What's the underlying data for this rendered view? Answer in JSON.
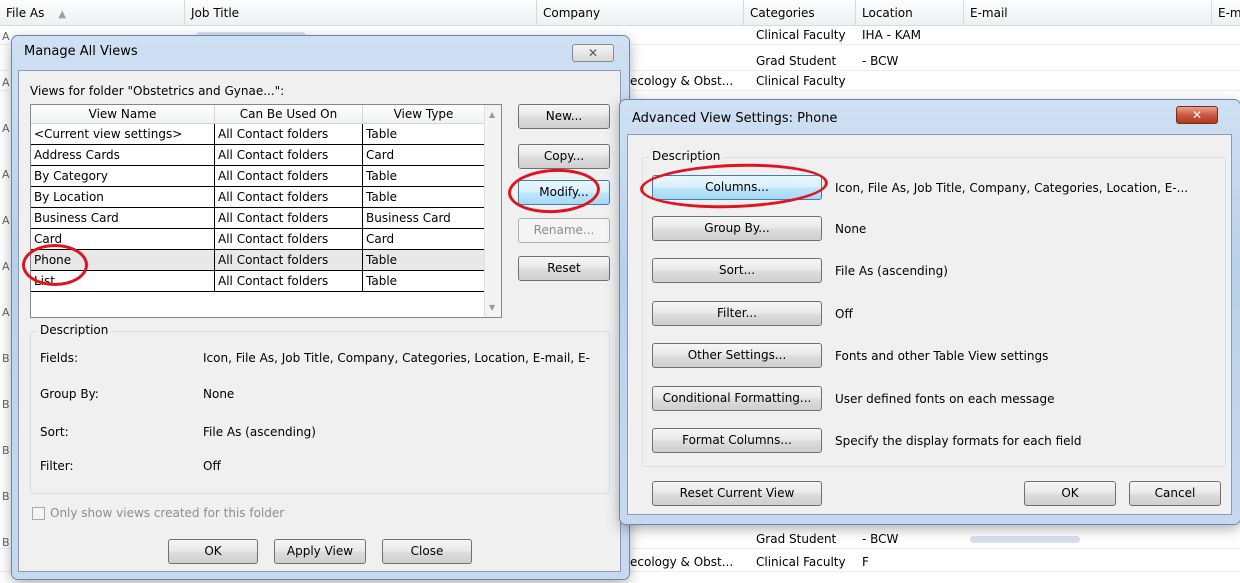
{
  "contacts": {
    "headers": {
      "file_as": "File As",
      "job_title": "Job Title",
      "company": "Company",
      "categories": "Categories",
      "location": "Location",
      "email": "E-mail",
      "email2": "E-m"
    },
    "rows": [
      {
        "company": "",
        "category": "Clinical Faculty",
        "location": "IHA - KAM"
      },
      {
        "company": "",
        "category": "Grad Student",
        "location": "- BCW"
      },
      {
        "company": "ecology & Obst...",
        "category": "Clinical Faculty",
        "location": ""
      },
      {
        "company": "",
        "category": "",
        "location": ""
      },
      {
        "company": "ecology & Obst...",
        "category": "",
        "location": ""
      },
      {
        "company": "",
        "category": "Grad Student",
        "location": "- BCW"
      },
      {
        "company": "ecology & Obst...",
        "category": "Clinical Faculty",
        "location": "F"
      }
    ]
  },
  "manage_views": {
    "title": "Manage All Views",
    "close_icon": "✕",
    "folder_label": "Views for folder \"Obstetrics and Gynae...\":",
    "columns": [
      "View Name",
      "Can Be Used On",
      "View Type"
    ],
    "views": [
      {
        "name": "<Current view settings>",
        "used_on": "All Contact folders",
        "type": "Table"
      },
      {
        "name": "Address Cards",
        "used_on": "All Contact folders",
        "type": "Card"
      },
      {
        "name": "By Category",
        "used_on": "All Contact folders",
        "type": "Table"
      },
      {
        "name": "By Location",
        "used_on": "All Contact folders",
        "type": "Table"
      },
      {
        "name": "Business Card",
        "used_on": "All Contact folders",
        "type": "Business Card"
      },
      {
        "name": "Card",
        "used_on": "All Contact folders",
        "type": "Card"
      },
      {
        "name": "Phone",
        "used_on": "All Contact folders",
        "type": "Table"
      },
      {
        "name": "List",
        "used_on": "All Contact folders",
        "type": "Table"
      }
    ],
    "buttons": {
      "new": "New...",
      "copy": "Copy...",
      "modify": "Modify...",
      "rename": "Rename...",
      "reset": "Reset"
    },
    "description": {
      "label": "Description",
      "fields_label": "Fields:",
      "fields_value": "Icon, File As, Job Title, Company, Categories, Location, E-mail, E-",
      "group_label": "Group By:",
      "group_value": "None",
      "sort_label": "Sort:",
      "sort_value": "File As (ascending)",
      "filter_label": "Filter:",
      "filter_value": "Off"
    },
    "only_show_label": "Only show views created for this folder",
    "footer": {
      "ok": "OK",
      "apply": "Apply View",
      "close": "Close"
    }
  },
  "advanced": {
    "title": "Advanced View Settings: Phone",
    "close_icon": "✕",
    "description_label": "Description",
    "items": [
      {
        "button": "Columns...",
        "value": "Icon, File As, Job Title, Company, Categories, Location, E-..."
      },
      {
        "button": "Group By...",
        "value": "None"
      },
      {
        "button": "Sort...",
        "value": "File As (ascending)"
      },
      {
        "button": "Filter...",
        "value": "Off"
      },
      {
        "button": "Other Settings...",
        "value": "Fonts and other Table View settings"
      },
      {
        "button": "Conditional Formatting...",
        "value": "User defined fonts on each message"
      },
      {
        "button": "Format Columns...",
        "value": "Specify the display formats for each field"
      }
    ],
    "footer": {
      "reset": "Reset Current View",
      "ok": "OK",
      "cancel": "Cancel"
    }
  }
}
